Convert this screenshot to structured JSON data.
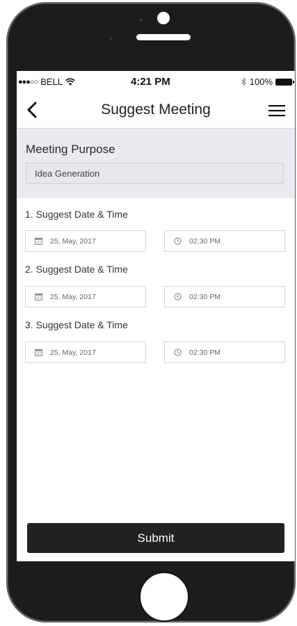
{
  "status_bar": {
    "signal": "●●●○○",
    "carrier": "BELL",
    "time": "4:21 PM",
    "battery": "100%"
  },
  "nav": {
    "title": "Suggest Meeting"
  },
  "purpose": {
    "label": "Meeting Purpose",
    "value": "Idea Generation"
  },
  "slots": [
    {
      "label": "1. Suggest Date & Time",
      "date": "25, May, 2017",
      "time": "02:30 PM"
    },
    {
      "label": "2. Suggest Date & Time",
      "date": "25, May, 2017",
      "time": "02:30 PM"
    },
    {
      "label": "3. Suggest Date & Time",
      "date": "25, May, 2017",
      "time": "02:30 PM"
    }
  ],
  "submit_label": "Submit",
  "icons": {
    "back": "chevron-left-icon",
    "menu": "hamburger-menu-icon",
    "date": "calendar-icon",
    "time": "clock-icon",
    "wifi": "wifi-icon",
    "bluetooth": "bluetooth-icon",
    "battery": "battery-icon"
  },
  "colors": {
    "button_bg": "#222222",
    "purpose_bg": "#eaeaf1",
    "phone_body": "#1d1c1c"
  }
}
